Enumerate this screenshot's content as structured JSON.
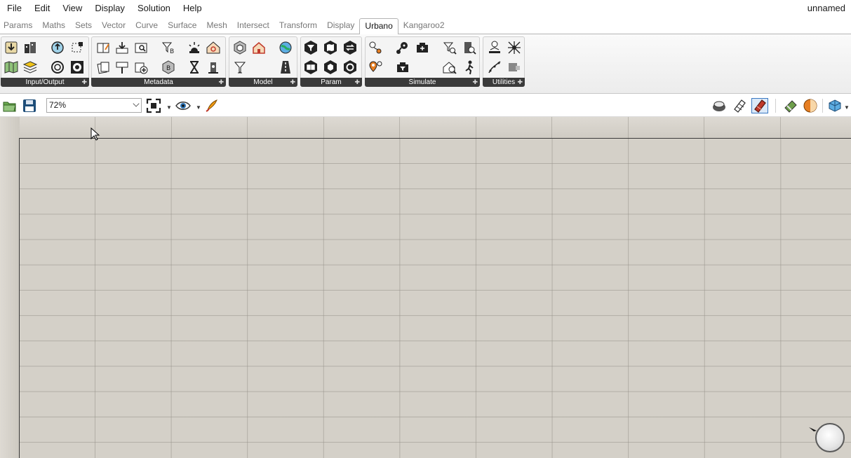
{
  "menu": {
    "items": [
      "File",
      "Edit",
      "View",
      "Display",
      "Solution",
      "Help"
    ],
    "document_name": "unnamed"
  },
  "tabs": {
    "items": [
      "Params",
      "Maths",
      "Sets",
      "Vector",
      "Curve",
      "Surface",
      "Mesh",
      "Intersect",
      "Transform",
      "Display",
      "Urbano",
      "Kangaroo2"
    ],
    "active": "Urbano"
  },
  "ribbon": {
    "groups": [
      "Input/Output",
      "Metadata",
      "Model",
      "Param",
      "Simulate",
      "Utilities"
    ]
  },
  "toolbar": {
    "zoom_value": "72%"
  },
  "colors": {
    "canvas": "#d4d0c8",
    "group_label_bg": "#3a3a3a",
    "active_toggle": "#c0392b"
  }
}
